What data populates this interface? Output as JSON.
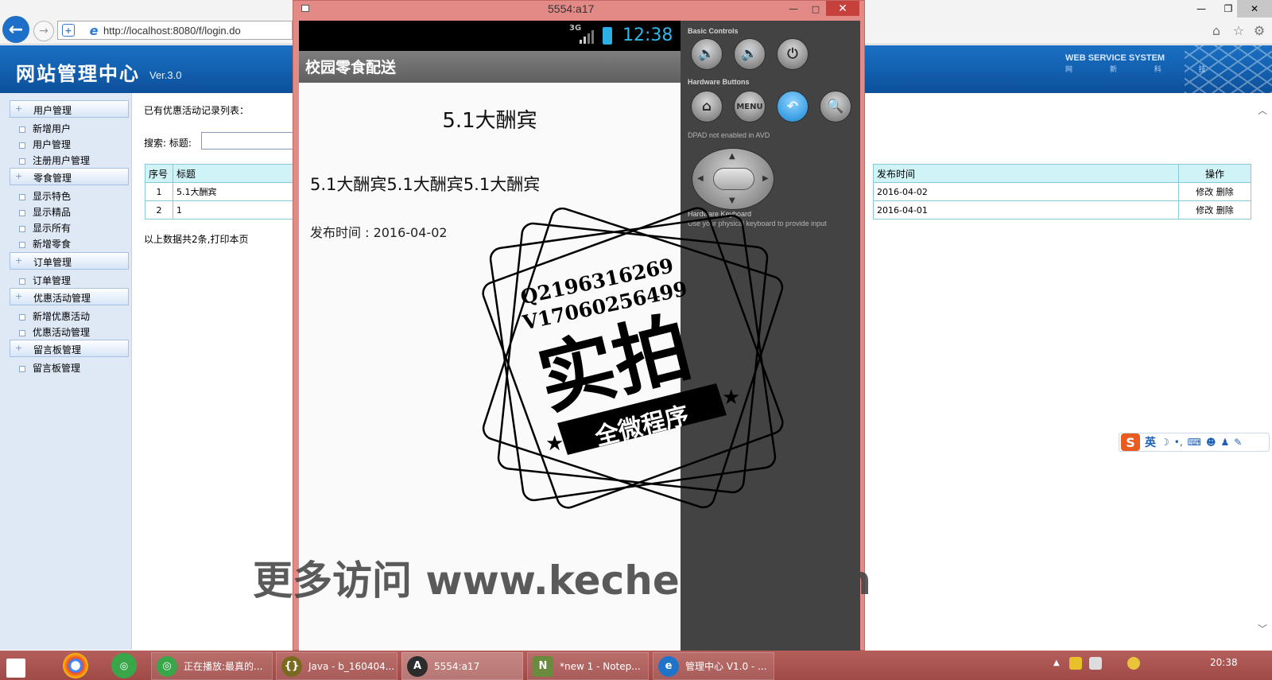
{
  "browser": {
    "url": "http://localhost:8080/f/login.do",
    "back_icon": "←",
    "forward_icon": "→"
  },
  "admin": {
    "site_title": "网站管理中心",
    "version": "Ver.3.0",
    "brand": "WEB SERVICE SYSTEM",
    "brand_sub": "网 新 科 技"
  },
  "sidebar": {
    "groups": [
      {
        "label": "用户管理",
        "items": [
          "新增用户",
          "用户管理",
          "注册用户管理"
        ]
      },
      {
        "label": "零食管理",
        "items": [
          "显示特色",
          "显示精品",
          "显示所有",
          "新增零食"
        ]
      },
      {
        "label": "订单管理",
        "items": [
          "订单管理"
        ]
      },
      {
        "label": "优惠活动管理",
        "items": [
          "新增优惠活动",
          "优惠活动管理"
        ]
      },
      {
        "label": "留言板管理",
        "items": [
          "留言板管理"
        ]
      }
    ]
  },
  "main": {
    "list_title": "已有优惠活动记录列表：",
    "search_label": "搜索:  标题:",
    "table": {
      "headers": [
        "序号",
        "标题",
        "发布时间",
        "操作"
      ],
      "rows": [
        {
          "id": "1",
          "title": "5.1大酬宾",
          "date": "2016-04-02",
          "edit": "修改",
          "delete": "删除"
        },
        {
          "id": "2",
          "title": "1",
          "date": "2016-04-01",
          "edit": "修改",
          "delete": "删除"
        }
      ]
    },
    "summary": "以上数据共2条,打印本页"
  },
  "emulator": {
    "window_title": "5554:a17",
    "status": {
      "network": "3G",
      "time": "12:38"
    },
    "app_title": "校园零食配送",
    "article_title": "5.1大酬宾",
    "article_body": "5.1大酬宾5.1大酬宾5.1大酬宾",
    "article_date": "发布时间 : 2016-04-02",
    "controls": {
      "basic_controls": "Basic Controls",
      "hardware_buttons": "Hardware Buttons",
      "dpad_label": "DPAD not enabled in AVD",
      "keyboard_label": "Hardware Keyboard",
      "keyboard_note": "Use your physical keyboard to provide input",
      "menu_label": "MENU"
    }
  },
  "watermark": {
    "qq": "Q2196316269",
    "vx": "V17060256499",
    "main": "实拍",
    "banner": "全微程序",
    "bottom": "更多访问 www.kecheng8.com"
  },
  "ime": {
    "lang": "英",
    "logo": "S"
  },
  "taskbar": {
    "buttons": [
      {
        "label": "正在播放:最真的...",
        "color": "#3aa64a",
        "icon": "◎"
      },
      {
        "label": "Java - b_160404...",
        "color": "#7a6a1f",
        "icon": "{}"
      },
      {
        "label": "5554:a17",
        "color": "#2c2c2c",
        "icon": "A"
      },
      {
        "label": "*new 1 - Notep...",
        "color": "#6a8b3d",
        "icon": "N"
      },
      {
        "label": "管理中心 V1.0 - ...",
        "color": "#1f73c9",
        "icon": "e"
      }
    ],
    "clock": "20:38"
  },
  "colors": {
    "accent": "#1361b1",
    "table_header": "#cff3f7",
    "emulator_frame": "#e38a86",
    "taskbar": "#a84f4c"
  }
}
